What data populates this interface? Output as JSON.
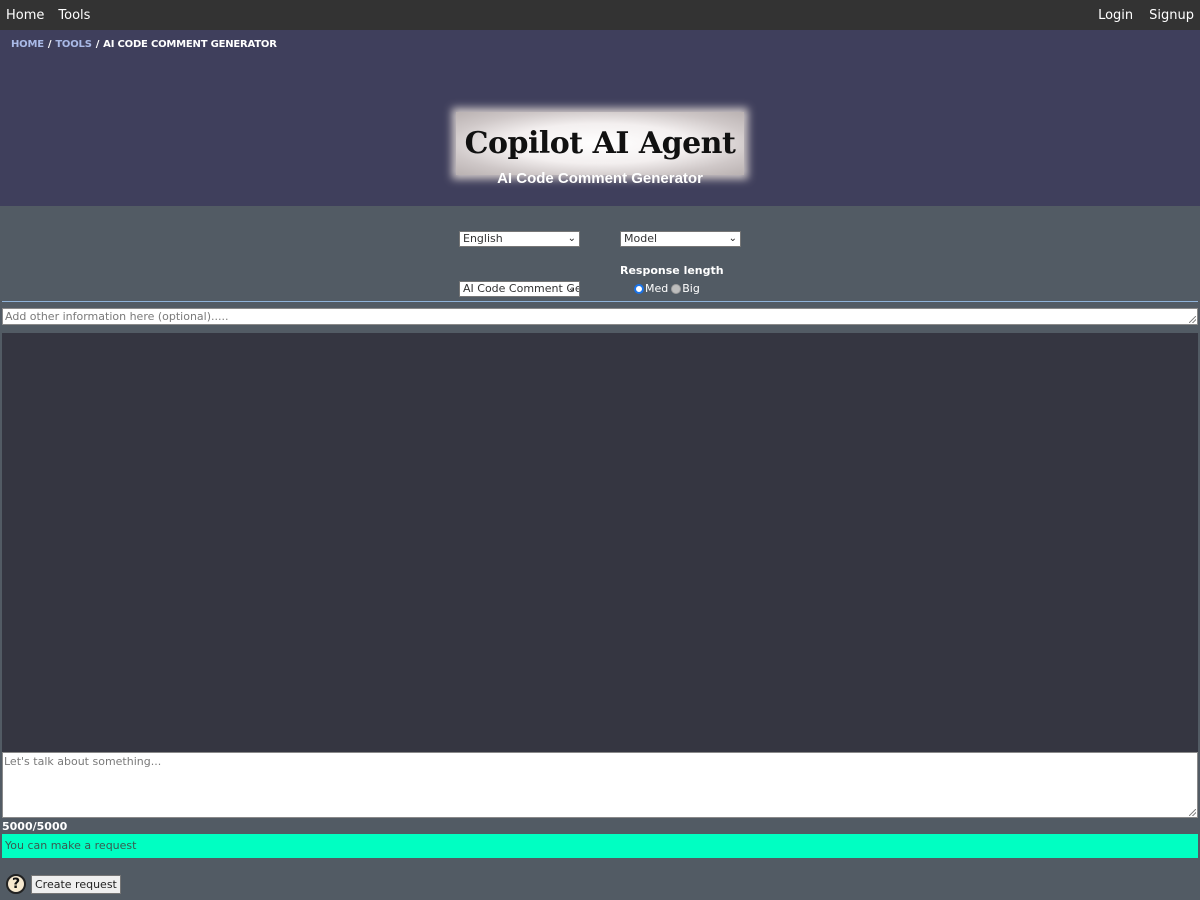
{
  "nav": {
    "left": [
      "Home",
      "Tools"
    ],
    "right": [
      "Login",
      "Signup"
    ]
  },
  "breadcrumb": {
    "items": [
      "HOME",
      "TOOLS",
      "AI CODE COMMENT GENERATOR"
    ],
    "separator": "/"
  },
  "header": {
    "logo_text": "Copilot AI Agent",
    "page_title": "AI Code Comment Generator"
  },
  "controls": {
    "language_select": "English",
    "model_select": "Model",
    "tool_select": "AI Code Comment Ge",
    "response_length_label": "Response length",
    "radio_med": "Med",
    "radio_big": "Big",
    "selected_length": "Med"
  },
  "info_input": {
    "placeholder": "Add other information here (optional)....."
  },
  "chat_input": {
    "placeholder": "Let's talk about something..."
  },
  "counter": "5000/5000",
  "status_message": "You can make a request",
  "actions": {
    "help": "?",
    "create_request": "Create request"
  },
  "colors": {
    "topnav_bg": "#333333",
    "header_bg": "#3f3f5c",
    "page_bg": "#525b64",
    "output_bg": "#353641",
    "status_bg": "#00ffc2"
  }
}
